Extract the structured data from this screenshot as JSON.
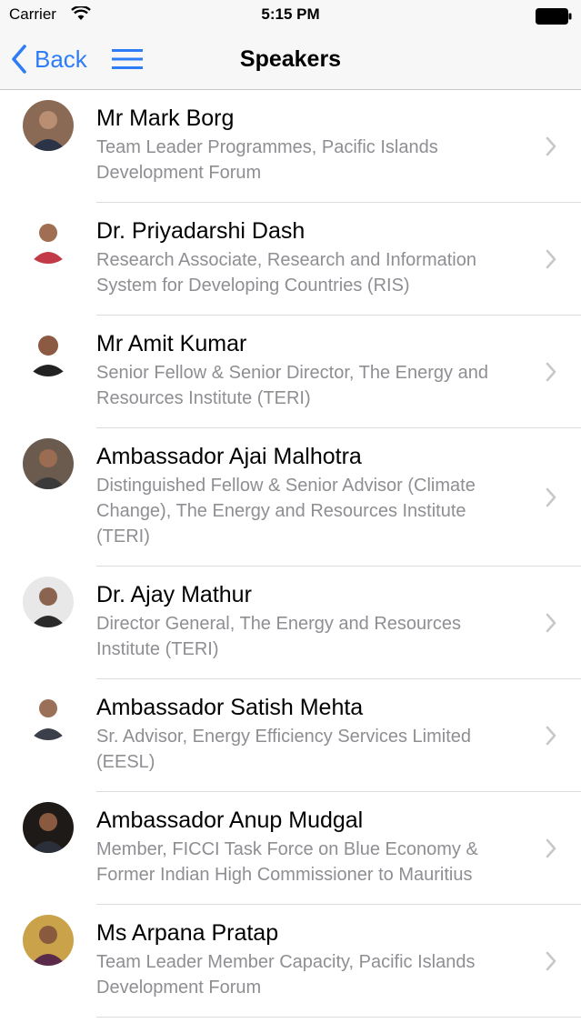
{
  "status_bar": {
    "carrier": "Carrier",
    "time": "5:15 PM",
    "wifi_icon": "wifi-icon",
    "battery_icon": "battery-icon"
  },
  "nav": {
    "back_label": "Back",
    "title": "Speakers",
    "menu_icon": "hamburger-menu-icon",
    "accent_color": "#2f7df6"
  },
  "speakers": [
    {
      "name": "Mr Mark Borg",
      "title": "Team Leader Programmes, Pacific Islands Development Forum"
    },
    {
      "name": "Dr. Priyadarshi Dash",
      "title": "Research Associate, Research and Information System for Developing Countries (RIS)"
    },
    {
      "name": "Mr Amit Kumar",
      "title": "Senior Fellow & Senior Director, The Energy and Resources Institute (TERI)"
    },
    {
      "name": "Ambassador Ajai Malhotra",
      "title": "Distinguished Fellow & Senior Advisor (Climate Change), The Energy and Resources Institute (TERI)"
    },
    {
      "name": "Dr. Ajay Mathur",
      "title": "Director General, The Energy and Resources Institute (TERI)"
    },
    {
      "name": "Ambassador Satish Mehta",
      "title": "Sr. Advisor, Energy Efficiency Services Limited (EESL)"
    },
    {
      "name": "Ambassador Anup Mudgal",
      "title": "Member, FICCI Task Force on Blue Economy & Former Indian High Commissioner to Mauritius"
    },
    {
      "name": "Ms Arpana Pratap",
      "title": "Team Leader Member Capacity, Pacific Islands Development Forum"
    }
  ]
}
